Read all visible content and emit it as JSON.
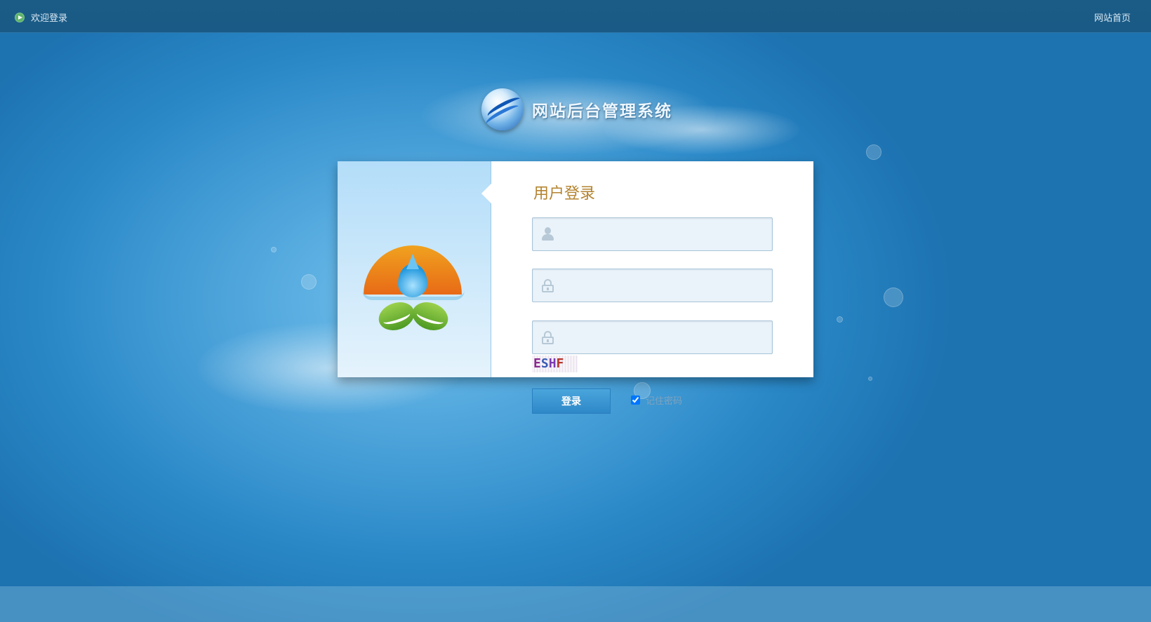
{
  "header": {
    "welcome_text": "欢迎登录",
    "home_link": "网站首页"
  },
  "brand": {
    "title": "网站后台管理系统"
  },
  "login": {
    "title": "用户登录",
    "username_value": "",
    "password_value": "",
    "captcha_value": "",
    "captcha_text": [
      "E",
      "S",
      "H",
      "F"
    ],
    "submit_label": "登录",
    "remember_label": "记住密码",
    "remember_checked": true
  },
  "colors": {
    "topbar": "#1b5c87",
    "title": "#b3832f",
    "button": "#3a96d2",
    "field_bg": "#eaf3fa"
  },
  "icons": [
    "play-icon",
    "globe-logo",
    "sun-drop-leaf-logo",
    "user-icon",
    "lock-icon"
  ]
}
